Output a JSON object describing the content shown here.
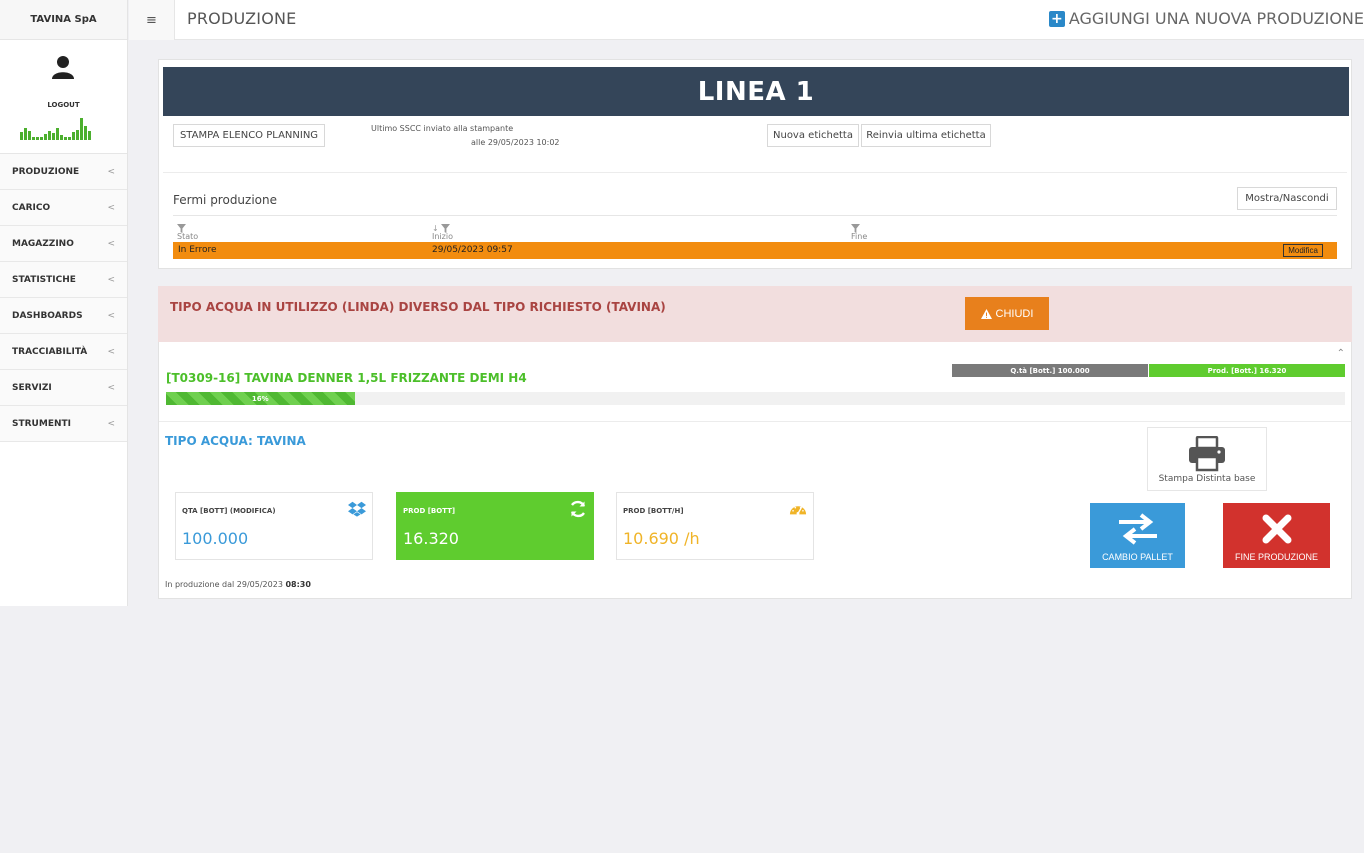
{
  "brand": "TAVINA SpA",
  "user": {
    "logout_label": "LOGOUT"
  },
  "sidebar": {
    "items": [
      {
        "label": "PRODUZIONE"
      },
      {
        "label": "CARICO"
      },
      {
        "label": "MAGAZZINO"
      },
      {
        "label": "STATISTICHE"
      },
      {
        "label": "DASHBOARDS"
      },
      {
        "label": "TRACCIABILITÀ"
      },
      {
        "label": "SERVIZI"
      },
      {
        "label": "STRUMENTI"
      }
    ],
    "chevron": "<"
  },
  "header": {
    "title": "PRODUZIONE",
    "add_label": "AGGIUNGI UNA NUOVA PRODUZIONE"
  },
  "line": {
    "title": "LINEA 1",
    "print_planning_label": "STAMPA ELENCO PLANNING",
    "sscc_line1": "Ultimo SSCC inviato alla stampante",
    "sscc_line2": "alle 29/05/2023 10:02",
    "new_label_btn": "Nuova etichetta",
    "resend_label_btn": "Reinvia ultima etichetta"
  },
  "stops": {
    "title": "Fermi produzione",
    "toggle_label": "Mostra/Nascondi",
    "columns": {
      "state": "Stato",
      "start": "Inizio",
      "end": "Fine"
    },
    "row": {
      "state": "In Errore",
      "start": "29/05/2023 09:57",
      "end": "",
      "edit_label": "Modifica"
    }
  },
  "alert": {
    "message": "TIPO ACQUA IN UTILIZZO (LINDA) DIVERSO DAL TIPO RICHIESTO (TAVINA)",
    "close_label": "CHIUDI"
  },
  "production": {
    "qty_bar_label": "Q.tà [Bott.] 100.000",
    "prod_bar_label": "Prod. [Bott.] 16.320",
    "product_title": "[T0309-16] TAVINA DENNER 1,5L FRIZZANTE DEMI H4",
    "progress_label": "16%",
    "progress_fraction": 0.16,
    "water_type": "TIPO ACQUA: TAVINA",
    "print_base_label": "Stampa Distinta base",
    "cards": {
      "qty": {
        "label": "QTA [BOTT] (MODIFICA)",
        "value": "100.000",
        "color": "#3a9ad9"
      },
      "prod": {
        "label": "PROD [BOTT]",
        "value": "16.320",
        "color": "#ffffff"
      },
      "rate": {
        "label": "PROD [BOTT/H]",
        "value": "10.690 /h",
        "color": "#f0b428"
      }
    },
    "change_pallet_label": "CAMBIO PALLET",
    "end_production_label": "FINE PRODUZIONE",
    "since_prefix": "In produzione dal 29/05/2023",
    "since_time": "08:30"
  },
  "colors": {
    "header_bg": "#344559",
    "error_orange": "#f28c0f",
    "alert_bg": "#f2dede",
    "alert_text": "#a94442",
    "green": "#5fcc2f",
    "blue": "#3a9ad9",
    "red": "#d2322d"
  },
  "icons": {
    "menu": "hamburger-icon",
    "add": "plus-square-icon",
    "user": "user-icon",
    "filter": "filter-icon",
    "warning": "warning-icon",
    "print": "printer-icon",
    "dropbox": "dropbox-icon",
    "refresh": "refresh-icon",
    "gauge": "dashboard-gauge-icon",
    "swap": "swap-arrows-icon",
    "close": "close-x-icon",
    "collapse": "chevron-up-icon"
  }
}
